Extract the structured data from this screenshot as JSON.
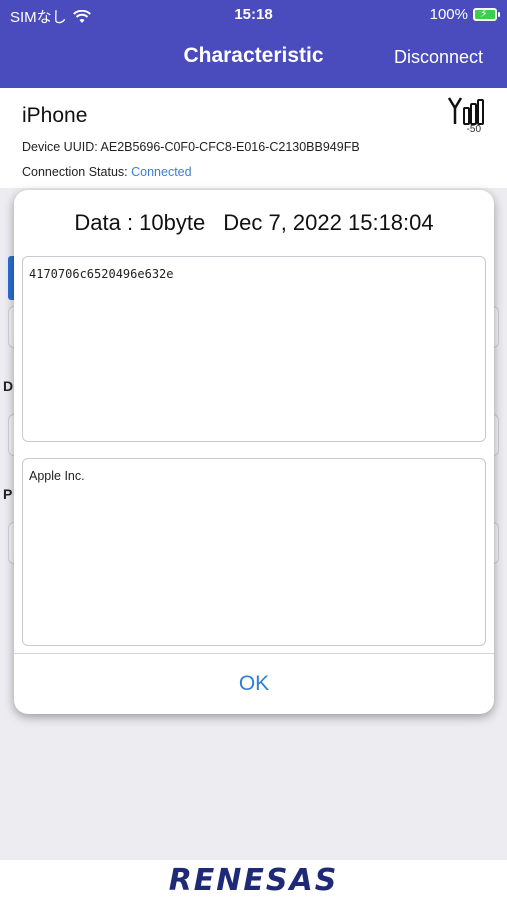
{
  "status_bar": {
    "carrier": "SIMなし",
    "time": "15:18",
    "battery": "100%"
  },
  "nav": {
    "title": "Characteristic",
    "disconnect": "Disconnect"
  },
  "device": {
    "name": "iPhone",
    "uuid_label": "Device UUID:",
    "uuid": "AE2B5696-C0F0-CFC8-E016-C2130BB949FB",
    "connection_label": "Connection Status:",
    "connection_status": "Connected",
    "rssi": "-50"
  },
  "background": {
    "label_d": "D",
    "label_p": "P"
  },
  "modal": {
    "data_size": "Data : 10byte",
    "timestamp": "Dec 7, 2022 15:18:04",
    "hex_value": "4170706c6520496e632e",
    "text_value": "Apple Inc.",
    "ok": "OK"
  },
  "footer": {
    "logo": "RENESAS"
  },
  "colors": {
    "nav_bg": "#4a4bbd",
    "accent": "#2f7fd6",
    "connected": "#3a7fd5",
    "logo": "#1e2a78"
  }
}
